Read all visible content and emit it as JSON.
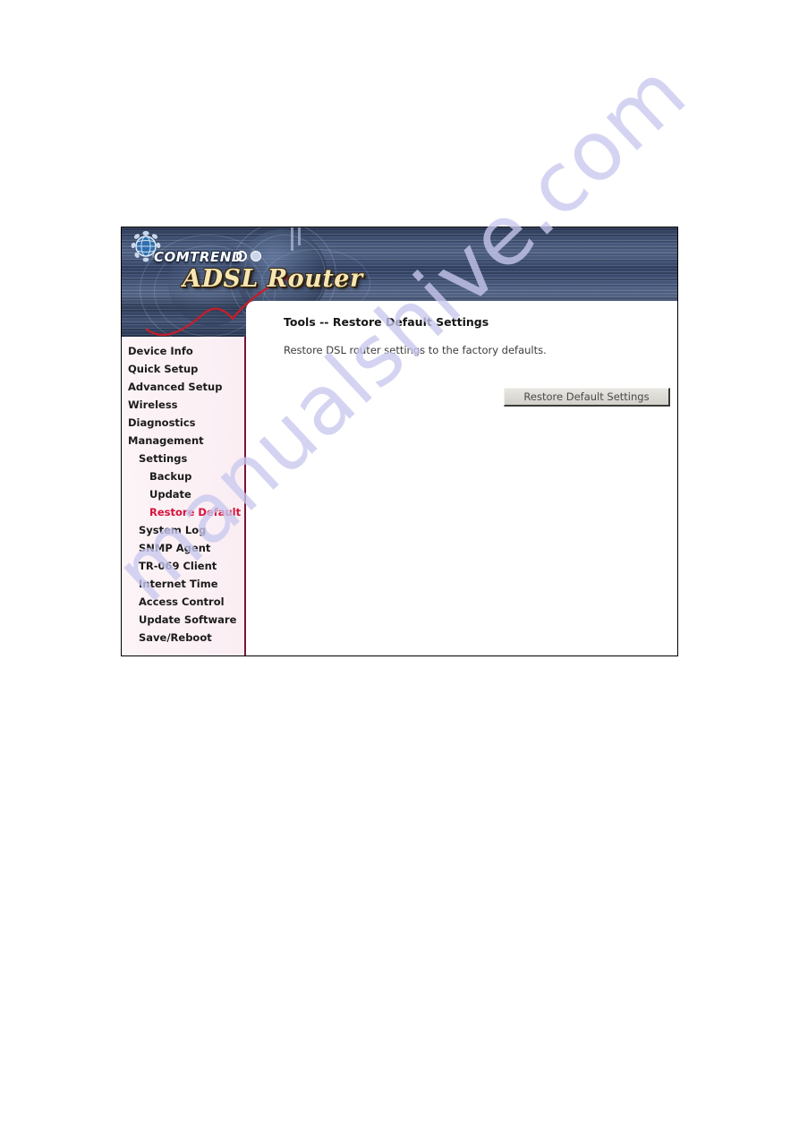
{
  "banner": {
    "brand": "COMTREND",
    "product_title": "ADSL Router",
    "logo_icon": "globe-logo-icon",
    "dot1_icon": "hollow-circle-icon",
    "dot2_icon": "filled-circle-icon",
    "swoosh_icon": "red-swoosh-arrow-icon"
  },
  "sidebar": {
    "items": [
      {
        "label": "Device Info",
        "level": 0,
        "active": false
      },
      {
        "label": "Quick Setup",
        "level": 0,
        "active": false
      },
      {
        "label": "Advanced Setup",
        "level": 0,
        "active": false
      },
      {
        "label": "Wireless",
        "level": 0,
        "active": false
      },
      {
        "label": "Diagnostics",
        "level": 0,
        "active": false
      },
      {
        "label": "Management",
        "level": 0,
        "active": false
      },
      {
        "label": "Settings",
        "level": 1,
        "active": false
      },
      {
        "label": "Backup",
        "level": 2,
        "active": false
      },
      {
        "label": "Update",
        "level": 2,
        "active": false
      },
      {
        "label": "Restore Default",
        "level": 2,
        "active": true
      },
      {
        "label": "System Log",
        "level": 1,
        "active": false
      },
      {
        "label": "SNMP Agent",
        "level": 1,
        "active": false
      },
      {
        "label": "TR-069 Client",
        "level": 1,
        "active": false
      },
      {
        "label": "Internet Time",
        "level": 1,
        "active": false
      },
      {
        "label": "Access Control",
        "level": 1,
        "active": false
      },
      {
        "label": "Update Software",
        "level": 1,
        "active": false
      },
      {
        "label": "Save/Reboot",
        "level": 1,
        "active": false
      }
    ]
  },
  "main": {
    "heading": "Tools -- Restore Default Settings",
    "description": "Restore DSL router settings to the factory defaults.",
    "restore_button_label": "Restore Default Settings"
  },
  "watermark": {
    "text": "manualshive.com"
  },
  "colors": {
    "active_item": "#d6123c",
    "sidebar_border": "#7a1538",
    "banner_dark": "#2a3854",
    "banner_light": "#5d6f93",
    "logo_title": "#f6e6b4",
    "watermark": "#c9c9ef",
    "button_face": "#dedcd6"
  }
}
